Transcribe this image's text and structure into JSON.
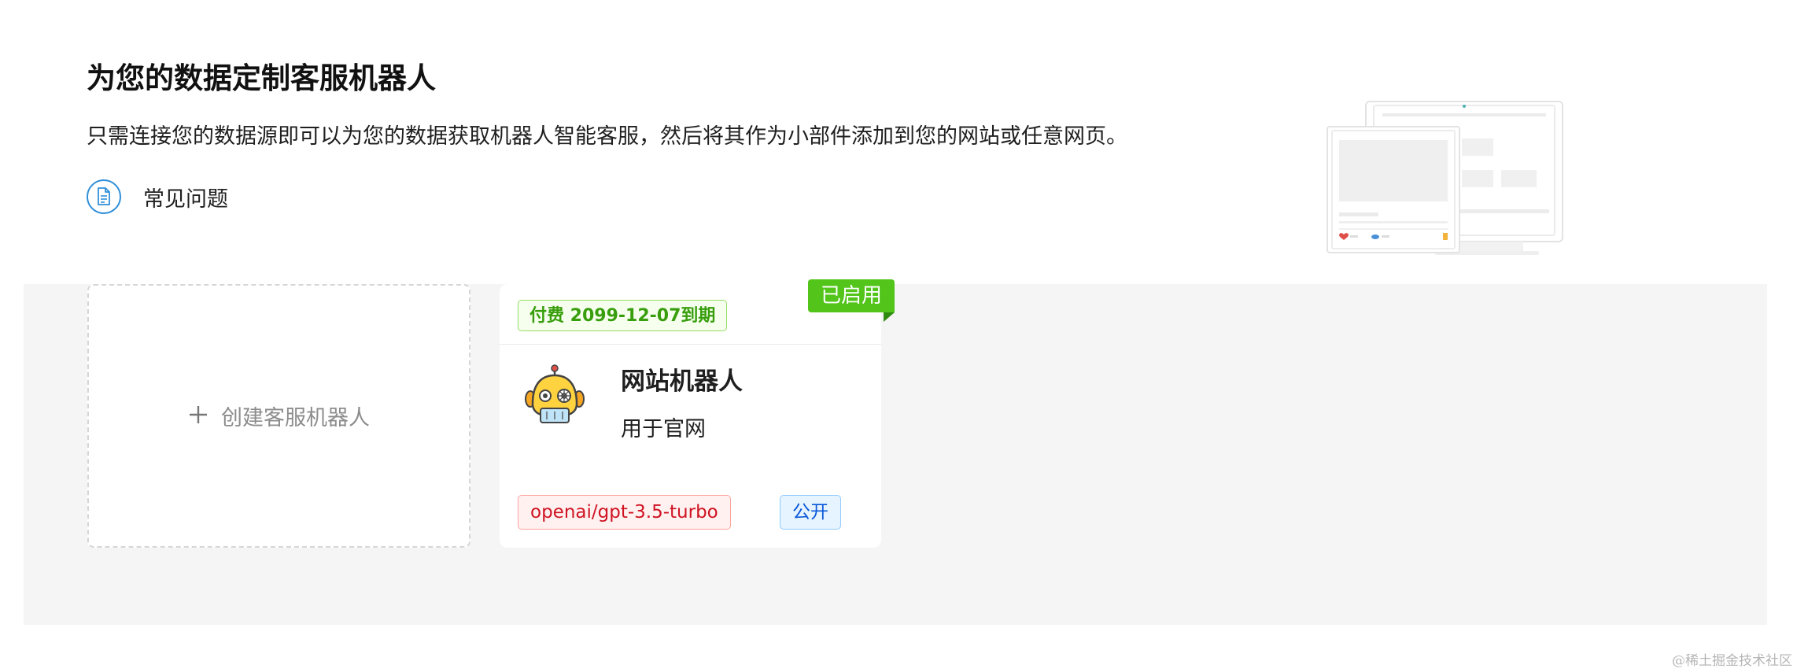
{
  "header": {
    "title": "为您的数据定制客服机器人",
    "subtitle": "只需连接您的数据源即可以为您的数据获取机器人智能客服，然后将其作为小部件添加到您的网站或任意网页。",
    "faq_label": "常见问题",
    "faq_icon": "document-icon"
  },
  "create_card": {
    "icon": "plus-icon",
    "label": "创建客服机器人"
  },
  "bots": [
    {
      "expire_label": "付费 2099-12-07到期",
      "status_label": "已启用",
      "name": "网站机器人",
      "description": "用于官网",
      "model": "openai/gpt-3.5-turbo",
      "visibility": "公开",
      "avatar_icon": "robot-icon"
    }
  ],
  "watermark": "@稀土掘金技术社区",
  "colors": {
    "primary_blue": "#2f8fd8",
    "enabled_green": "#52c41a",
    "model_red": "#cf1322",
    "visibility_blue": "#0958d9",
    "content_bg": "#f5f5f5"
  }
}
